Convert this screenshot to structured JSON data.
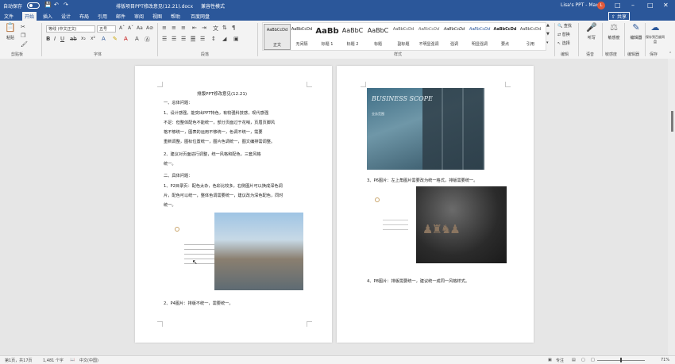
{
  "titlebar": {
    "autosave_label": "自动保存",
    "autosave_state": "关",
    "doc_title": "排版项目PPT修改意见(12.21).docx",
    "compat_label": "兼容性模式",
    "user": "Lisa's PPT - Max",
    "avatar_initial": "L",
    "save_icon": "save-icon",
    "undo_icon": "undo-icon",
    "redo_icon": "redo-icon"
  },
  "tabs": [
    "文件",
    "开始",
    "插入",
    "设计",
    "布局",
    "引用",
    "邮件",
    "审阅",
    "视图",
    "帮助",
    "百度网盘"
  ],
  "share_label": "共享",
  "ribbon": {
    "clipboard": {
      "paste": "粘贴",
      "label": "剪贴板"
    },
    "font": {
      "name": "等线 (中文正文)",
      "size": "五号",
      "label": "字体"
    },
    "paragraph": {
      "label": "段落"
    },
    "styles": {
      "label": "样式",
      "items": [
        {
          "sample": "AaBbCcDd",
          "name": "正文"
        },
        {
          "sample": "AaBbCcDd",
          "name": "无间隔"
        },
        {
          "sample": "AaBb",
          "name": "标题 1"
        },
        {
          "sample": "AaBbC",
          "name": "标题 2"
        },
        {
          "sample": "AaBbC",
          "name": "标题"
        },
        {
          "sample": "AaBbCcDd",
          "name": "副标题"
        },
        {
          "sample": "AaBbCcDd",
          "name": "不明显强调"
        },
        {
          "sample": "AaBbCcDd",
          "name": "强调"
        },
        {
          "sample": "AaBbCcDd",
          "name": "明显强调"
        },
        {
          "sample": "AaBbCcDd",
          "name": "要点"
        },
        {
          "sample": "AaBbCcDd",
          "name": "引用"
        }
      ]
    },
    "editing": {
      "find": "查找",
      "replace": "替换",
      "select": "选择",
      "label": "编辑"
    },
    "voice": {
      "dictate": "听写",
      "label": "语音"
    },
    "sensitivity": {
      "btn": "敏感度",
      "label": "敏感度"
    },
    "editor": {
      "btn": "编辑器",
      "label": "编辑器"
    },
    "baidu": {
      "btn": "保存到百度网盘",
      "label": "保存"
    }
  },
  "page1": {
    "title": "排版PPT修改意见(12.21)",
    "lines": [
      "一、总体问题：",
      "1、设计感强，能突出PPT特色，有较强科技感，现代感强",
      "不足：但整体配色不能统一，部分页面过于花哨，页眉页脚风",
      "格不够统一，图表的运用不够统一，色调不统一，需要",
      "重新调整，图标位置统一，图片色调统一，图文编排需调整。",
      "2、建议对页面进行调整，统一风格和配色，三套风格",
      "统一。",
      "二、具体问题：",
      "1、P2目录页：配色太杂，色彩比较多，右侧图片可以换成深色调",
      "片，配色可以统一，整体色调需要统一，建议改为深色配色，同时",
      "统一。"
    ],
    "caption": "2、P4图片：排版不统一，需要统一。"
  },
  "page2": {
    "cover_title": "BUSINESS SCOPE",
    "cover_sub": "业务范围",
    "caption1": "3、P6图片：左上角图片需要改为统一格式，排版需要统一。",
    "caption2": "4、P8图片：排版需要统一，建议统一成同一风格样式。"
  },
  "status": {
    "page": "第1页，共17页",
    "words": "1,481 个字",
    "lang": "中文(中国)",
    "focus": "专注",
    "zoom": "71%"
  }
}
